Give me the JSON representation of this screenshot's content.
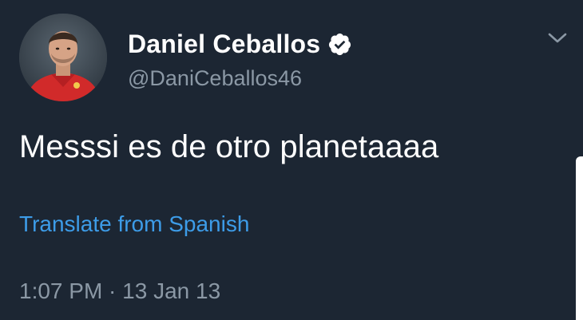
{
  "tweet": {
    "author": {
      "display_name": "Daniel Ceballos",
      "handle": "@DaniCeballos46",
      "verified": true
    },
    "text": "Messsi es de otro planetaaaa",
    "translate_label": "Translate from Spanish",
    "timestamp": "1:07 PM · 13 Jan 13"
  },
  "icons": {
    "verified": "verified-badge-icon",
    "menu": "chevron-down-icon"
  },
  "colors": {
    "background": "#1c2633",
    "primary_text": "#ffffff",
    "secondary_text": "#8b98a5",
    "link": "#3d9ce8"
  }
}
